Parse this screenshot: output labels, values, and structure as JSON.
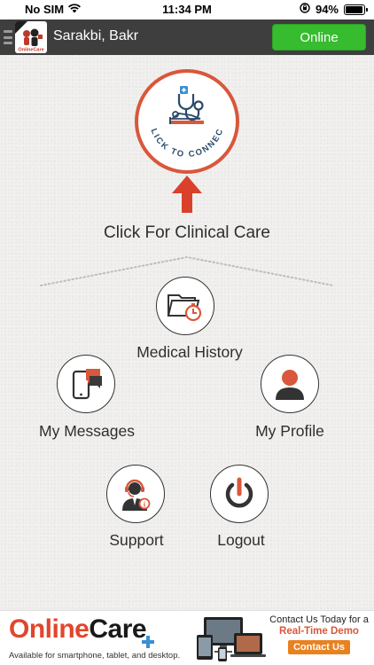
{
  "status_bar": {
    "carrier": "No SIM",
    "time": "11:34 PM",
    "battery_percent": "94%",
    "battery_level": 0.94,
    "icons": [
      "wifi-icon",
      "orientation-lock-icon",
      "battery-icon"
    ]
  },
  "header": {
    "logo_icon": "onlinecare-logo-icon",
    "menu_icon": "hamburger-icon",
    "user_name": "Sarakbi, Bakr",
    "status_button": "Online",
    "status_color": "#37bb2f"
  },
  "connect": {
    "ring_text": "CLICK TO CONNECT",
    "icon": "stethoscope-patient-icon",
    "arrow_icon": "arrow-up-icon",
    "title": "Click For Clinical Care",
    "accent_color": "#d9573b"
  },
  "menu": {
    "medical_history": {
      "label": "Medical History",
      "icon": "folder-clock-icon"
    },
    "messages": {
      "label": "My Messages",
      "icon": "phone-chat-icon"
    },
    "profile": {
      "label": "My Profile",
      "icon": "person-icon"
    },
    "support": {
      "label": "Support",
      "icon": "headset-agent-icon"
    },
    "logout": {
      "label": "Logout",
      "icon": "power-icon"
    }
  },
  "ad": {
    "brand_part1": "Online",
    "brand_part2": "Care",
    "tagline": "Available for smartphone, tablet, and desktop.",
    "contact_line1": "Contact Us Today for a",
    "contact_line2": "Real-Time Demo",
    "contact_button": "Contact Us"
  }
}
